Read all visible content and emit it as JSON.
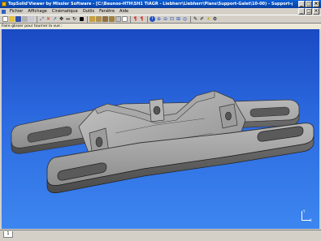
{
  "window": {
    "title": "TopSolid'Viewer by Missler Software - [C:\\Beunoo-HTH\\SH1 TIAGR - Liebherr\\Liebherr\\Plans\\Support-Galet\\10-00) - Support-galet.top.TopVw]",
    "buttons": {
      "minimize": "_",
      "maximize": "□",
      "close": "×"
    }
  },
  "menu": {
    "items": [
      "Fichier",
      "Affichage",
      "Cinématique",
      "Outils",
      "Fenêtre",
      "Aide"
    ]
  },
  "toolbar": {
    "icons": [
      "new-icon",
      "open-icon",
      "save-icon",
      "print-icon",
      "copy-icon",
      "zoom-fit-icon",
      "scale-icon",
      "draw-icon",
      "arrow-icon",
      "move-icon",
      "rotate-icon",
      "stop-icon",
      "view-icon",
      "view-icon",
      "view-icon",
      "view-icon",
      "view-icon",
      "clipboard-icon",
      "page-icon",
      "tool-icon",
      "tool-icon",
      "info-icon",
      "zoom-icon",
      "zoom-icon",
      "zoom-icon",
      "zoom-icon",
      "zoom-icon",
      "pen-icon",
      "pen-icon",
      "light-icon",
      "settings-icon"
    ]
  },
  "hint": {
    "text": "Faire glisser pour tourner la vue :"
  },
  "axis": {
    "x": "X",
    "y": "Y"
  },
  "tab": {
    "label": "1"
  },
  "colors": {
    "viewport_top": "#1a4ac4",
    "viewport_bottom": "#3d86f0",
    "part": "#8e8e8e",
    "titlebar": "#0a5fd8"
  }
}
